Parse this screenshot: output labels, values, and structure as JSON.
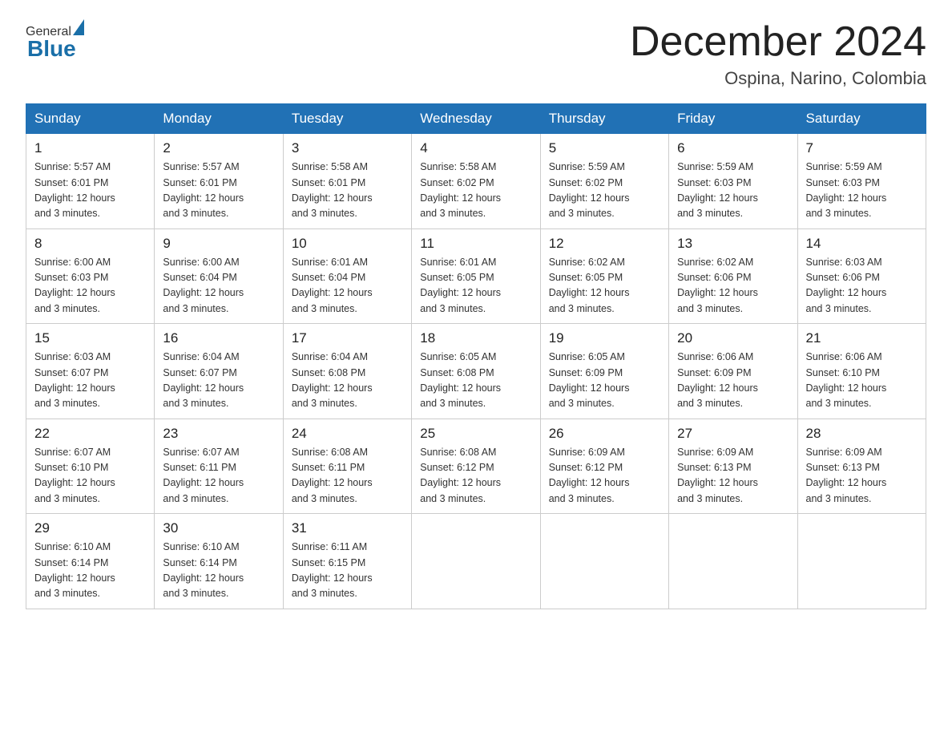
{
  "header": {
    "logo_general": "General",
    "logo_blue": "Blue",
    "month_title": "December 2024",
    "location": "Ospina, Narino, Colombia"
  },
  "days_of_week": [
    "Sunday",
    "Monday",
    "Tuesday",
    "Wednesday",
    "Thursday",
    "Friday",
    "Saturday"
  ],
  "weeks": [
    [
      {
        "day": "1",
        "sunrise": "5:57 AM",
        "sunset": "6:01 PM",
        "daylight": "12 hours and 3 minutes."
      },
      {
        "day": "2",
        "sunrise": "5:57 AM",
        "sunset": "6:01 PM",
        "daylight": "12 hours and 3 minutes."
      },
      {
        "day": "3",
        "sunrise": "5:58 AM",
        "sunset": "6:01 PM",
        "daylight": "12 hours and 3 minutes."
      },
      {
        "day": "4",
        "sunrise": "5:58 AM",
        "sunset": "6:02 PM",
        "daylight": "12 hours and 3 minutes."
      },
      {
        "day": "5",
        "sunrise": "5:59 AM",
        "sunset": "6:02 PM",
        "daylight": "12 hours and 3 minutes."
      },
      {
        "day": "6",
        "sunrise": "5:59 AM",
        "sunset": "6:03 PM",
        "daylight": "12 hours and 3 minutes."
      },
      {
        "day": "7",
        "sunrise": "5:59 AM",
        "sunset": "6:03 PM",
        "daylight": "12 hours and 3 minutes."
      }
    ],
    [
      {
        "day": "8",
        "sunrise": "6:00 AM",
        "sunset": "6:03 PM",
        "daylight": "12 hours and 3 minutes."
      },
      {
        "day": "9",
        "sunrise": "6:00 AM",
        "sunset": "6:04 PM",
        "daylight": "12 hours and 3 minutes."
      },
      {
        "day": "10",
        "sunrise": "6:01 AM",
        "sunset": "6:04 PM",
        "daylight": "12 hours and 3 minutes."
      },
      {
        "day": "11",
        "sunrise": "6:01 AM",
        "sunset": "6:05 PM",
        "daylight": "12 hours and 3 minutes."
      },
      {
        "day": "12",
        "sunrise": "6:02 AM",
        "sunset": "6:05 PM",
        "daylight": "12 hours and 3 minutes."
      },
      {
        "day": "13",
        "sunrise": "6:02 AM",
        "sunset": "6:06 PM",
        "daylight": "12 hours and 3 minutes."
      },
      {
        "day": "14",
        "sunrise": "6:03 AM",
        "sunset": "6:06 PM",
        "daylight": "12 hours and 3 minutes."
      }
    ],
    [
      {
        "day": "15",
        "sunrise": "6:03 AM",
        "sunset": "6:07 PM",
        "daylight": "12 hours and 3 minutes."
      },
      {
        "day": "16",
        "sunrise": "6:04 AM",
        "sunset": "6:07 PM",
        "daylight": "12 hours and 3 minutes."
      },
      {
        "day": "17",
        "sunrise": "6:04 AM",
        "sunset": "6:08 PM",
        "daylight": "12 hours and 3 minutes."
      },
      {
        "day": "18",
        "sunrise": "6:05 AM",
        "sunset": "6:08 PM",
        "daylight": "12 hours and 3 minutes."
      },
      {
        "day": "19",
        "sunrise": "6:05 AM",
        "sunset": "6:09 PM",
        "daylight": "12 hours and 3 minutes."
      },
      {
        "day": "20",
        "sunrise": "6:06 AM",
        "sunset": "6:09 PM",
        "daylight": "12 hours and 3 minutes."
      },
      {
        "day": "21",
        "sunrise": "6:06 AM",
        "sunset": "6:10 PM",
        "daylight": "12 hours and 3 minutes."
      }
    ],
    [
      {
        "day": "22",
        "sunrise": "6:07 AM",
        "sunset": "6:10 PM",
        "daylight": "12 hours and 3 minutes."
      },
      {
        "day": "23",
        "sunrise": "6:07 AM",
        "sunset": "6:11 PM",
        "daylight": "12 hours and 3 minutes."
      },
      {
        "day": "24",
        "sunrise": "6:08 AM",
        "sunset": "6:11 PM",
        "daylight": "12 hours and 3 minutes."
      },
      {
        "day": "25",
        "sunrise": "6:08 AM",
        "sunset": "6:12 PM",
        "daylight": "12 hours and 3 minutes."
      },
      {
        "day": "26",
        "sunrise": "6:09 AM",
        "sunset": "6:12 PM",
        "daylight": "12 hours and 3 minutes."
      },
      {
        "day": "27",
        "sunrise": "6:09 AM",
        "sunset": "6:13 PM",
        "daylight": "12 hours and 3 minutes."
      },
      {
        "day": "28",
        "sunrise": "6:09 AM",
        "sunset": "6:13 PM",
        "daylight": "12 hours and 3 minutes."
      }
    ],
    [
      {
        "day": "29",
        "sunrise": "6:10 AM",
        "sunset": "6:14 PM",
        "daylight": "12 hours and 3 minutes."
      },
      {
        "day": "30",
        "sunrise": "6:10 AM",
        "sunset": "6:14 PM",
        "daylight": "12 hours and 3 minutes."
      },
      {
        "day": "31",
        "sunrise": "6:11 AM",
        "sunset": "6:15 PM",
        "daylight": "12 hours and 3 minutes."
      },
      null,
      null,
      null,
      null
    ]
  ],
  "labels": {
    "sunrise": "Sunrise:",
    "sunset": "Sunset:",
    "daylight": "Daylight:"
  }
}
